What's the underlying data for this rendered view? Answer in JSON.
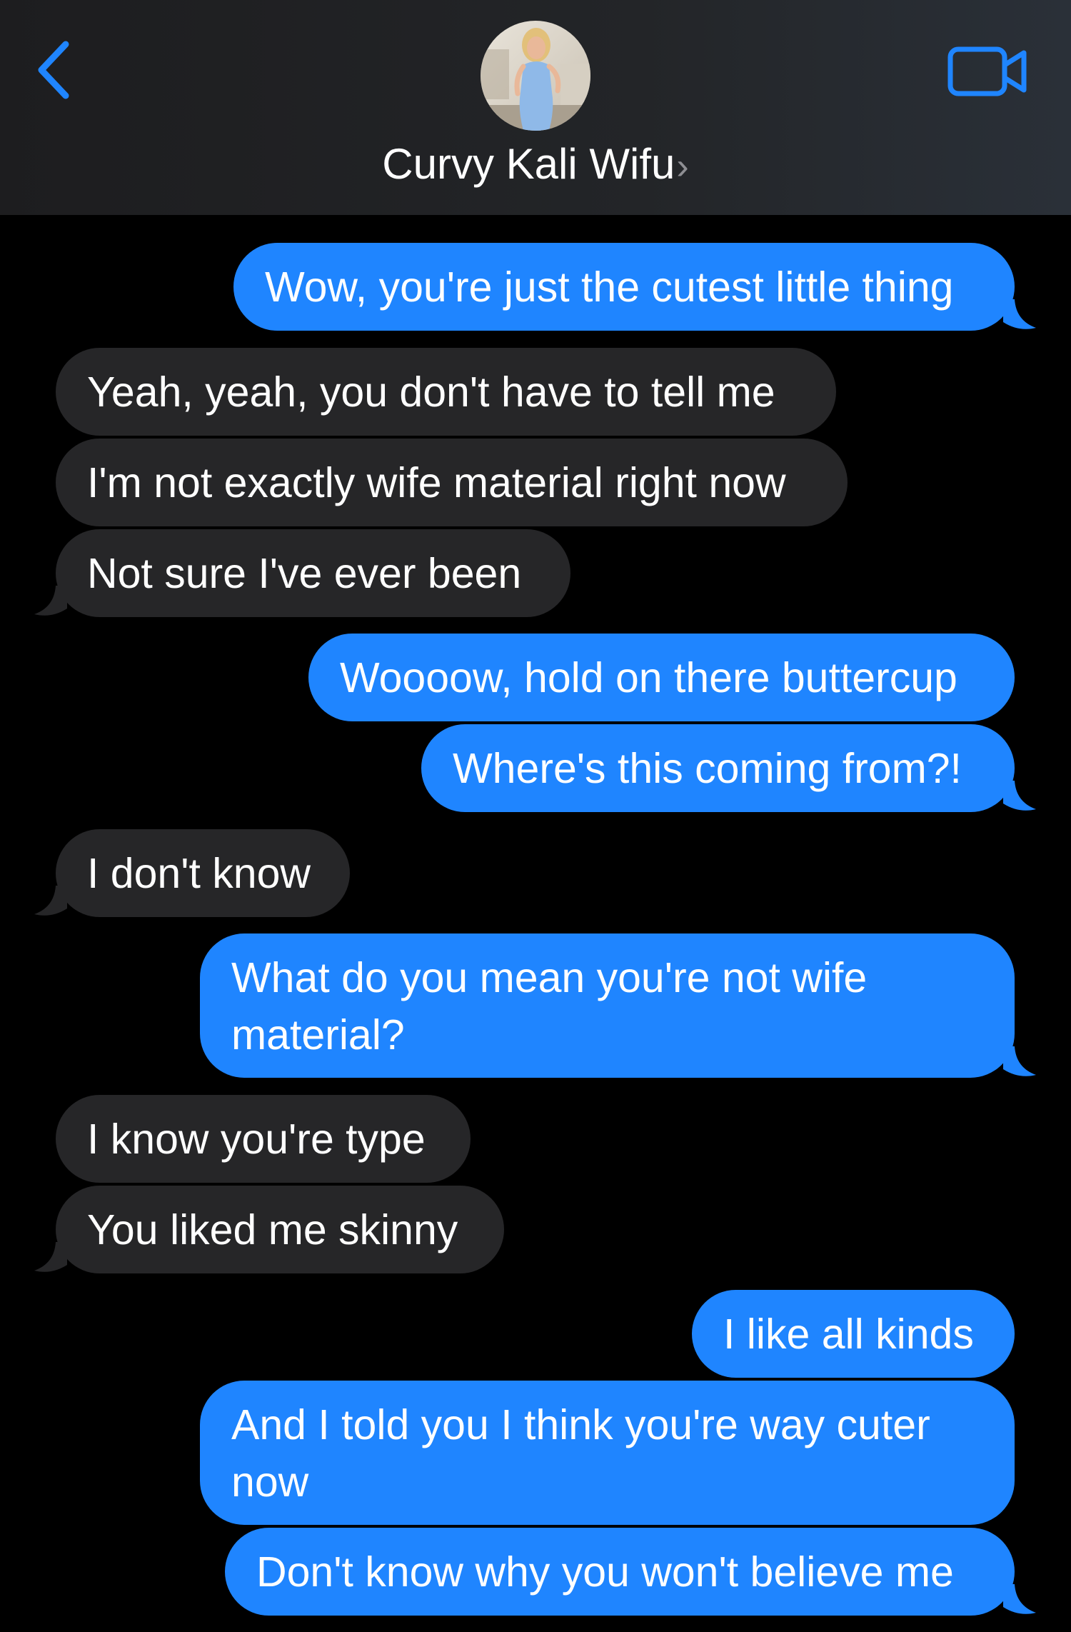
{
  "header": {
    "contact_name": "Curvy Kali Wifu",
    "name_chevron": "›",
    "back_icon": "chevron-left-icon",
    "video_icon": "video-camera-icon"
  },
  "colors": {
    "accent": "#1f85ff",
    "sent_bubble": "#1f85ff",
    "received_bubble": "#262628",
    "background": "#000000"
  },
  "messages": [
    {
      "side": "sent",
      "text": "Wow, you're just the cutest little thing"
    },
    {
      "side": "received",
      "text": "Yeah, yeah, you don't have to tell me"
    },
    {
      "side": "received",
      "text": "I'm not exactly wife material right now"
    },
    {
      "side": "received",
      "text": "Not sure I've ever been"
    },
    {
      "side": "sent",
      "text": "Woooow, hold on there buttercup"
    },
    {
      "side": "sent",
      "text": "Where's this coming from?!"
    },
    {
      "side": "received",
      "text": "I don't know"
    },
    {
      "side": "sent",
      "text": "What do you mean you're not wife material?"
    },
    {
      "side": "received",
      "text": "I know you're type"
    },
    {
      "side": "received",
      "text": "You liked me skinny"
    },
    {
      "side": "sent",
      "text": "I like all kinds"
    },
    {
      "side": "sent",
      "text": "And I told you I think you're way cuter now"
    },
    {
      "side": "sent",
      "text": "Don't know why you won't believe me"
    }
  ]
}
